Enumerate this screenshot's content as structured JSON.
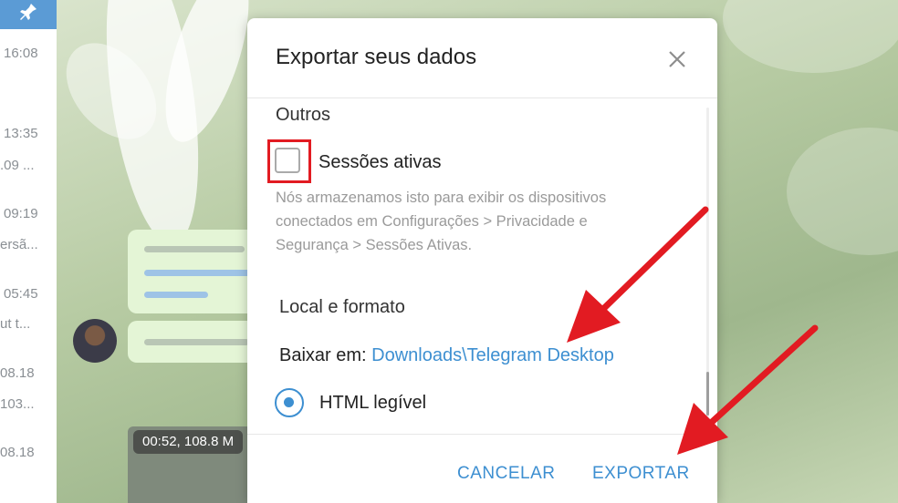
{
  "sidebar": {
    "rows": [
      {
        "text": "16:08"
      },
      {
        "text": "13:35"
      },
      {
        "text": ".09 ..."
      },
      {
        "text": "09:19"
      },
      {
        "text": "ersã..."
      },
      {
        "text": "05:45"
      },
      {
        "text": "ut t..."
      },
      {
        "text": "08.18"
      },
      {
        "text": "103..."
      },
      {
        "text": "08.18"
      }
    ]
  },
  "chat": {
    "video_label": "00:52, 108.8 M"
  },
  "dialog": {
    "title": "Exportar seus dados",
    "section_other": "Outros",
    "checkbox_label": "Sessões ativas",
    "checkbox_checked": false,
    "description_lines": [
      "Nós armazenamos isto para exibir os dispositivos",
      "conectados em Configurações > Privacidade e",
      "Segurança > Sessões Ativas."
    ],
    "section_location": "Local e formato",
    "path_label": "Baixar em: ",
    "path_value": "Downloads\\Telegram Desktop",
    "radio_label": "HTML legível",
    "cancel_label": "CANCELAR",
    "export_label": "EXPORTAR"
  },
  "colors": {
    "accent": "#3d8fd1",
    "highlight": "#e21b22",
    "arrow": "#e21b22"
  }
}
